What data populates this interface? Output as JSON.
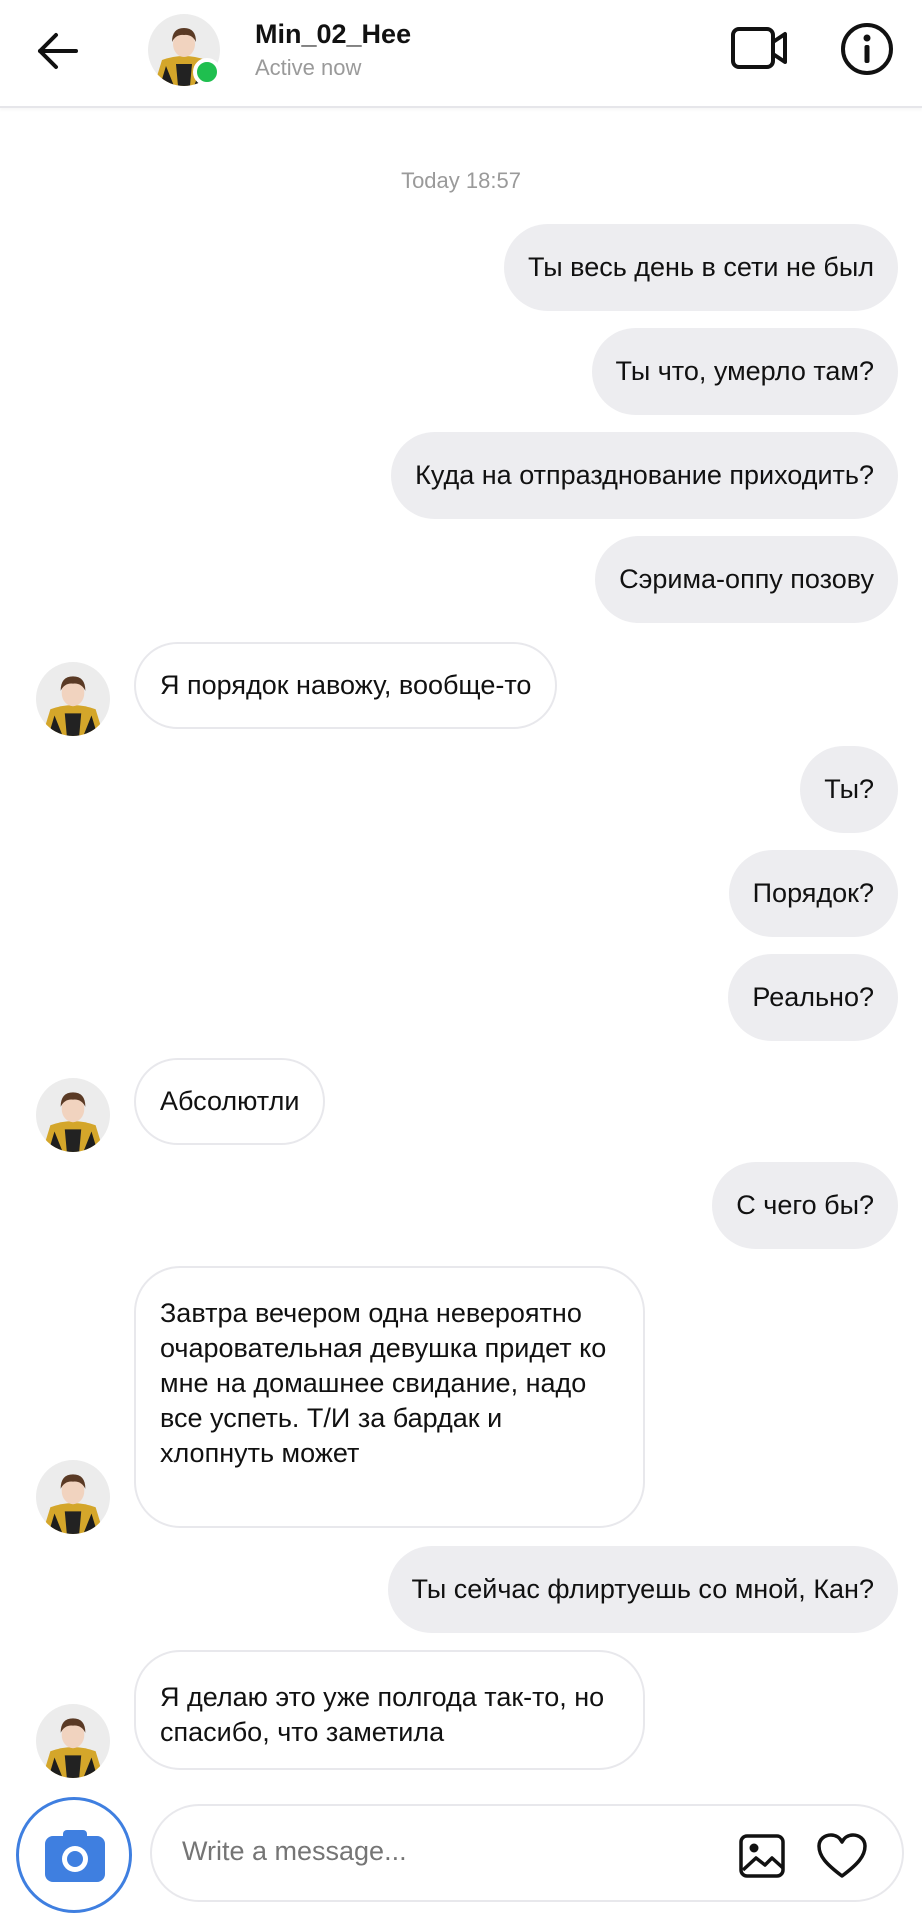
{
  "header": {
    "username": "Min_02_Hee",
    "status": "Active now",
    "icons": {
      "back": "arrow-left-icon",
      "video": "video-camera-icon",
      "info": "info-circle-icon"
    },
    "online_color": "#1fbf4f"
  },
  "chat": {
    "timestamp": "Today 18:57",
    "messages": [
      {
        "direction": "out",
        "text": "Ты весь день в сети не был"
      },
      {
        "direction": "out",
        "text": "Ты что, умерло там?"
      },
      {
        "direction": "out",
        "text": "Куда на отпразднование приходить?"
      },
      {
        "direction": "out",
        "text": "Сэрима-оппу позову"
      },
      {
        "direction": "in",
        "text": "Я порядок навожу, вообще-то"
      },
      {
        "direction": "out",
        "text": "Ты?"
      },
      {
        "direction": "out",
        "text": "Порядок?"
      },
      {
        "direction": "out",
        "text": "Реально?"
      },
      {
        "direction": "in",
        "text": "Абсолютли"
      },
      {
        "direction": "out",
        "text": "С чего бы?"
      },
      {
        "direction": "in",
        "text": "Завтра вечером одна невероятно очаровательная девушка придет ко мне на домашнее свидание, надо все успеть. Т/И за бардак и хлопнуть может"
      },
      {
        "direction": "out",
        "text": "Ты сейчас флиртуешь со мной, Кан?"
      },
      {
        "direction": "in",
        "text": "Я делаю это уже полгода так-то, но спасибо, что заметила"
      }
    ],
    "outgoing_bubble_color": "#ededf0",
    "incoming_bubble_color": "#ffffff"
  },
  "composer": {
    "placeholder": "Write a message...",
    "icons": {
      "camera": "camera-icon",
      "gallery": "image-icon",
      "like": "heart-icon"
    },
    "camera_color": "#3f7fe0"
  }
}
